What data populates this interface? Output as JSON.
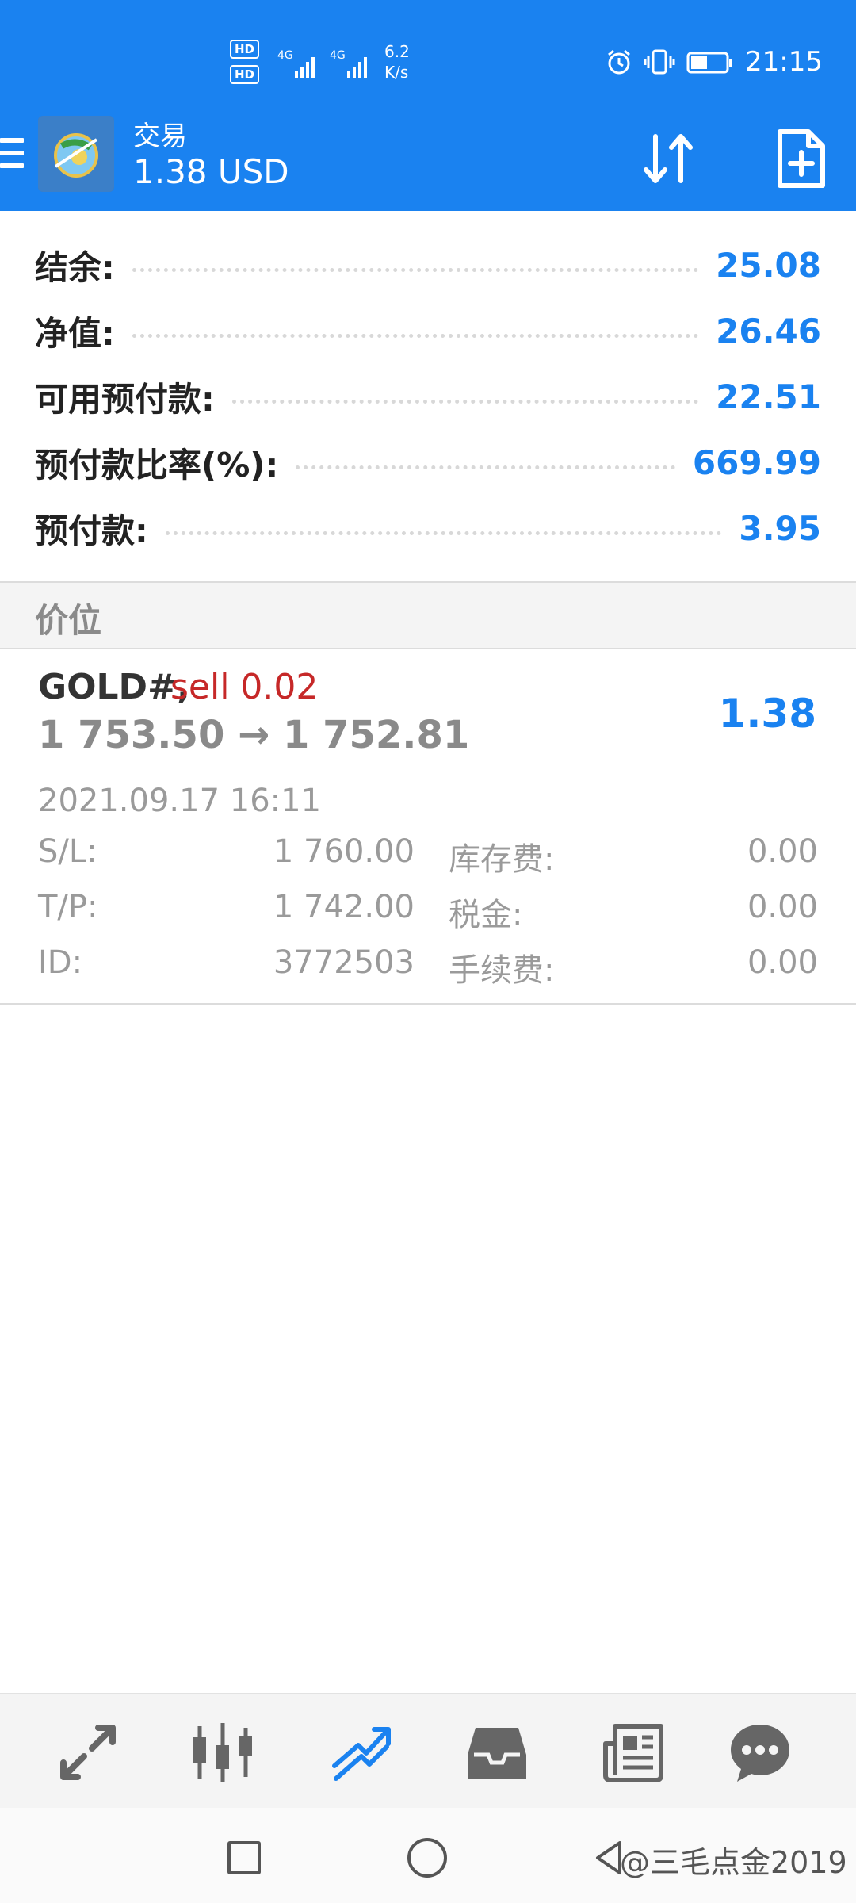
{
  "status_bar": {
    "hd1": "HD",
    "hd2": "HD",
    "net1": "4G",
    "net2": "4G",
    "speed_value": "6.2",
    "speed_unit": "K/s",
    "time": "21:15",
    "icons": [
      "alarm-icon",
      "vibrate-icon",
      "battery-icon"
    ]
  },
  "appbar": {
    "title": "交易",
    "subtitle": "1.38 USD",
    "icons": [
      "menu-icon",
      "app-logo",
      "sort-icon",
      "new-order-icon"
    ]
  },
  "summary": [
    {
      "label": "结余:",
      "value": "25.08"
    },
    {
      "label": "净值:",
      "value": "26.46"
    },
    {
      "label": "可用预付款:",
      "value": "22.51"
    },
    {
      "label": "预付款比率(%):",
      "value": "669.99"
    },
    {
      "label": "预付款:",
      "value": "3.95"
    }
  ],
  "section": {
    "title": "价位"
  },
  "position": {
    "symbol": "GOLD#,",
    "type": "sell 0.02",
    "prices": "1 753.50 → 1 752.81",
    "profit": "1.38",
    "time": "2021.09.17 16:11",
    "details": [
      {
        "label1": "S/L:",
        "value1": "1 760.00",
        "label2": "库存费:",
        "value2": "0.00"
      },
      {
        "label1": "T/P:",
        "value1": "1 742.00",
        "label2": "税金:",
        "value2": "0.00"
      },
      {
        "label1": "ID:",
        "value1": "3772503",
        "label2": "手续费:",
        "value2": "0.00"
      }
    ]
  },
  "tabs": [
    "quotes-icon",
    "chart-icon",
    "trade-icon",
    "history-icon",
    "news-icon",
    "chat-icon"
  ],
  "colors": {
    "accent": "#1a82f0",
    "sell": "#c62828",
    "muted": "#9a9a9a"
  },
  "watermark": "@三毛点金2019"
}
